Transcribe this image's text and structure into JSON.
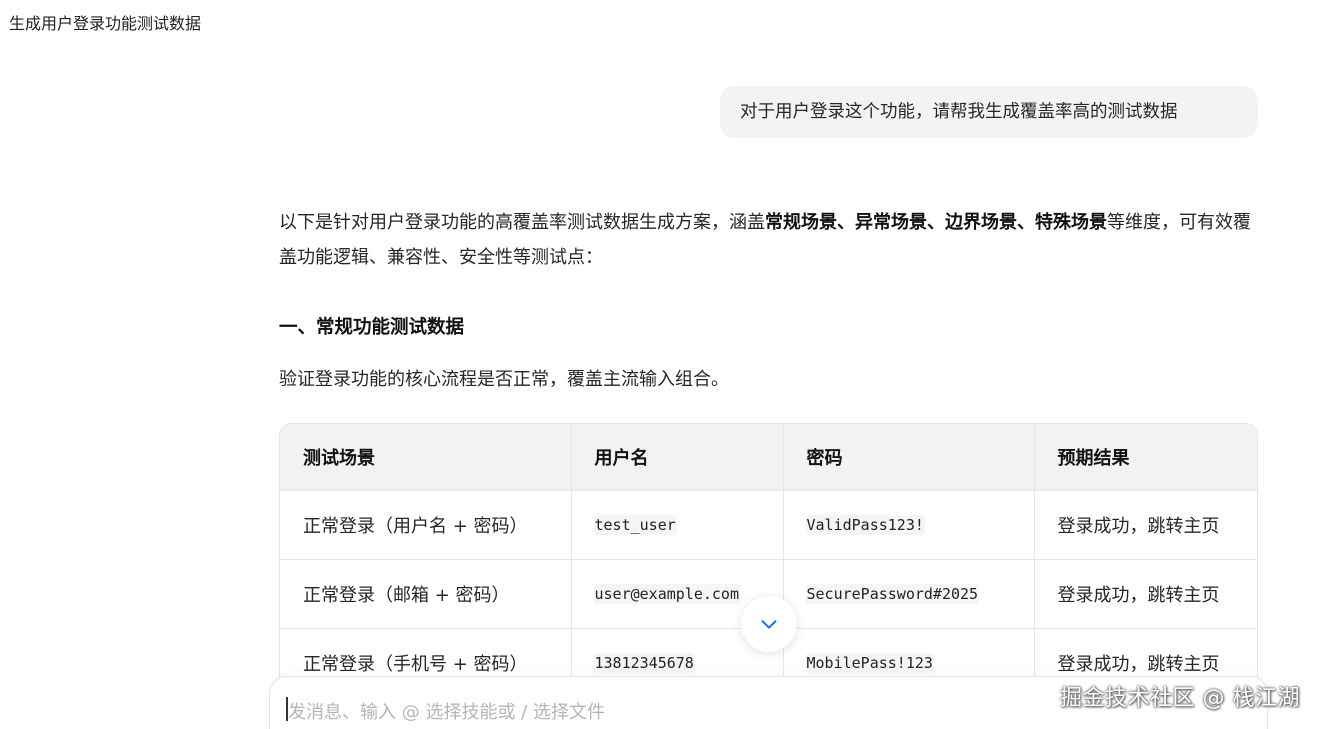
{
  "chat": {
    "title": "生成用户登录功能测试数据"
  },
  "user_message": {
    "text": "对于用户登录这个功能，请帮我生成覆盖率高的测试数据"
  },
  "answer": {
    "intro_prefix": "以下是针对用户登录功能的高覆盖率测试数据生成方案，涵盖",
    "intro_bold": "常规场景、异常场景、边界场景、特殊场景",
    "intro_suffix": "等维度，可有效覆盖功能逻辑、兼容性、安全性等测试点：",
    "section_heading": "一、常规功能测试数据",
    "section_desc": "验证登录功能的核心流程是否正常，覆盖主流输入组合。"
  },
  "table": {
    "headers": [
      "测试场景",
      "用户名",
      "密码",
      "预期结果"
    ],
    "rows": [
      [
        "正常登录（用户名 + 密码）",
        "test_user",
        "ValidPass123!",
        "登录成功，跳转主页"
      ],
      [
        "正常登录（邮箱 + 密码）",
        "user@example.com",
        "SecurePassword#2025",
        "登录成功，跳转主页"
      ],
      [
        "正常登录（手机号 + 密码）",
        "13812345678",
        "MobilePass!123",
        "登录成功，跳转主页"
      ]
    ]
  },
  "composer": {
    "placeholder": "发消息、输入 @ 选择技能或 / 选择文件"
  },
  "watermark": {
    "text": "掘金技术社区 @ 栈江湖"
  },
  "colors": {
    "bubble_bg": "#f3f3f3",
    "table_header_bg": "#f2f2f2",
    "border": "#e6e6e6",
    "accent": "#1a73e8"
  },
  "icons": {
    "scroll_down": "chevron-down-icon"
  }
}
